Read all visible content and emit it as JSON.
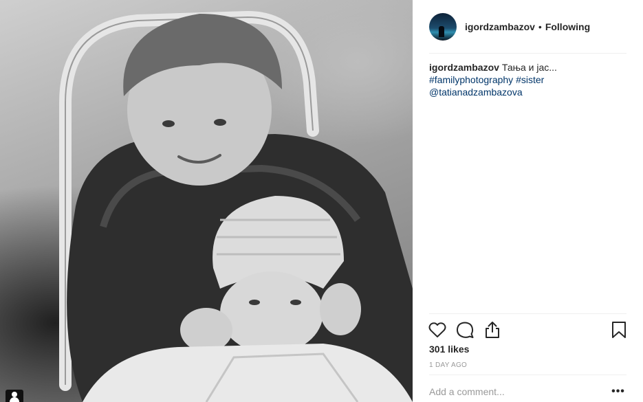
{
  "post": {
    "photo": {
      "description_icon": "profile-user-icon"
    },
    "author": {
      "username": "igordzambazov",
      "separator": "•",
      "follow_state": "Following",
      "avatar_icon": "avatar-image"
    },
    "caption": {
      "username": "igordzambazov",
      "text": "Тања и јас...",
      "hashtag_1": "#familyphotography",
      "hashtag_2": "#sister",
      "mention": "@tatianadzambazova"
    },
    "actions": {
      "like_icon": "heart-icon",
      "comment_icon": "comment-bubble-icon",
      "share_icon": "share-icon",
      "save_icon": "bookmark-icon"
    },
    "likes": "301 likes",
    "timestamp": "1 DAY AGO",
    "comment": {
      "placeholder": "Add a comment...",
      "more_label": "•••"
    }
  },
  "colors": {
    "text": "#262626",
    "link": "#003569",
    "muted": "#999999",
    "divider": "#efefef"
  }
}
